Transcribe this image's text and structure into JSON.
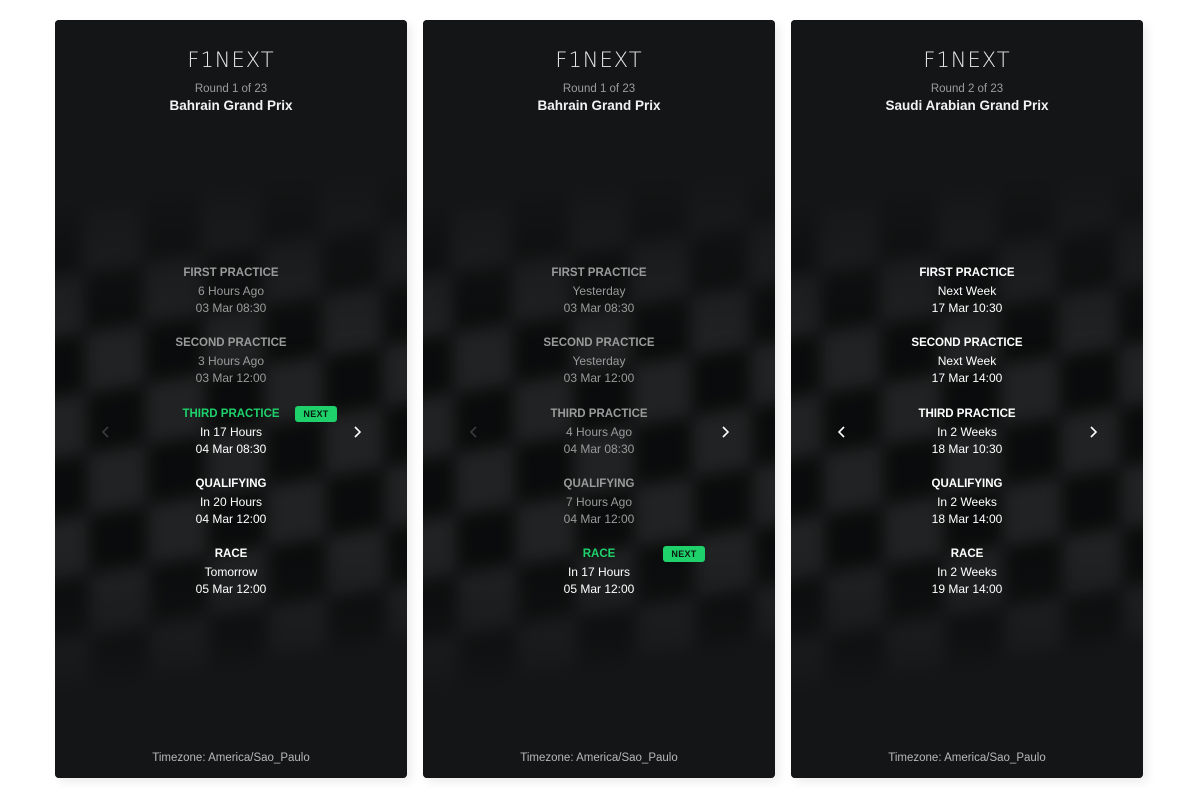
{
  "panels": [
    {
      "logo": "F1NEXT",
      "round": "Round 1 of 23",
      "gp_name": "Bahrain Grand Prix",
      "timezone": "Timezone: America/Sao_Paulo",
      "next_badge": "NEXT",
      "left_arrow_enabled": false,
      "right_arrow_enabled": true,
      "sessions": [
        {
          "title": "FIRST PRACTICE",
          "relative": "6 Hours Ago",
          "date": "03 Mar 08:30",
          "state": "past"
        },
        {
          "title": "SECOND PRACTICE",
          "relative": "3 Hours Ago",
          "date": "03 Mar 12:00",
          "state": "past"
        },
        {
          "title": "THIRD PRACTICE",
          "relative": "In 17 Hours",
          "date": "04 Mar 08:30",
          "state": "next"
        },
        {
          "title": "QUALIFYING",
          "relative": "In 20 Hours",
          "date": "04 Mar 12:00",
          "state": "upcoming"
        },
        {
          "title": "RACE",
          "relative": "Tomorrow",
          "date": "05 Mar 12:00",
          "state": "upcoming"
        }
      ]
    },
    {
      "logo": "F1NEXT",
      "round": "Round 1 of 23",
      "gp_name": "Bahrain Grand Prix",
      "timezone": "Timezone: America/Sao_Paulo",
      "next_badge": "NEXT",
      "left_arrow_enabled": false,
      "right_arrow_enabled": true,
      "sessions": [
        {
          "title": "FIRST PRACTICE",
          "relative": "Yesterday",
          "date": "03 Mar 08:30",
          "state": "past"
        },
        {
          "title": "SECOND PRACTICE",
          "relative": "Yesterday",
          "date": "03 Mar 12:00",
          "state": "past"
        },
        {
          "title": "THIRD PRACTICE",
          "relative": "4 Hours Ago",
          "date": "04 Mar 08:30",
          "state": "past"
        },
        {
          "title": "QUALIFYING",
          "relative": "7 Hours Ago",
          "date": "04 Mar 12:00",
          "state": "past"
        },
        {
          "title": "RACE",
          "relative": "In 17 Hours",
          "date": "05 Mar 12:00",
          "state": "next"
        }
      ]
    },
    {
      "logo": "F1NEXT",
      "round": "Round 2 of 23",
      "gp_name": "Saudi Arabian Grand Prix",
      "timezone": "Timezone: America/Sao_Paulo",
      "next_badge": "NEXT",
      "left_arrow_enabled": true,
      "right_arrow_enabled": true,
      "sessions": [
        {
          "title": "FIRST PRACTICE",
          "relative": "Next Week",
          "date": "17 Mar 10:30",
          "state": "upcoming"
        },
        {
          "title": "SECOND PRACTICE",
          "relative": "Next Week",
          "date": "17 Mar 14:00",
          "state": "upcoming"
        },
        {
          "title": "THIRD PRACTICE",
          "relative": "In 2 Weeks",
          "date": "18 Mar 10:30",
          "state": "upcoming"
        },
        {
          "title": "QUALIFYING",
          "relative": "In 2 Weeks",
          "date": "18 Mar 14:00",
          "state": "upcoming"
        },
        {
          "title": "RACE",
          "relative": "In 2 Weeks",
          "date": "19 Mar 14:00",
          "state": "upcoming"
        }
      ]
    }
  ],
  "colors": {
    "panel_bg": "#141516",
    "accent_green": "#1fd16b",
    "past_text": "#9a9a9a",
    "active_text": "#ffffff"
  },
  "icons": {
    "prev": "chevron-left-icon",
    "next": "chevron-right-icon"
  }
}
